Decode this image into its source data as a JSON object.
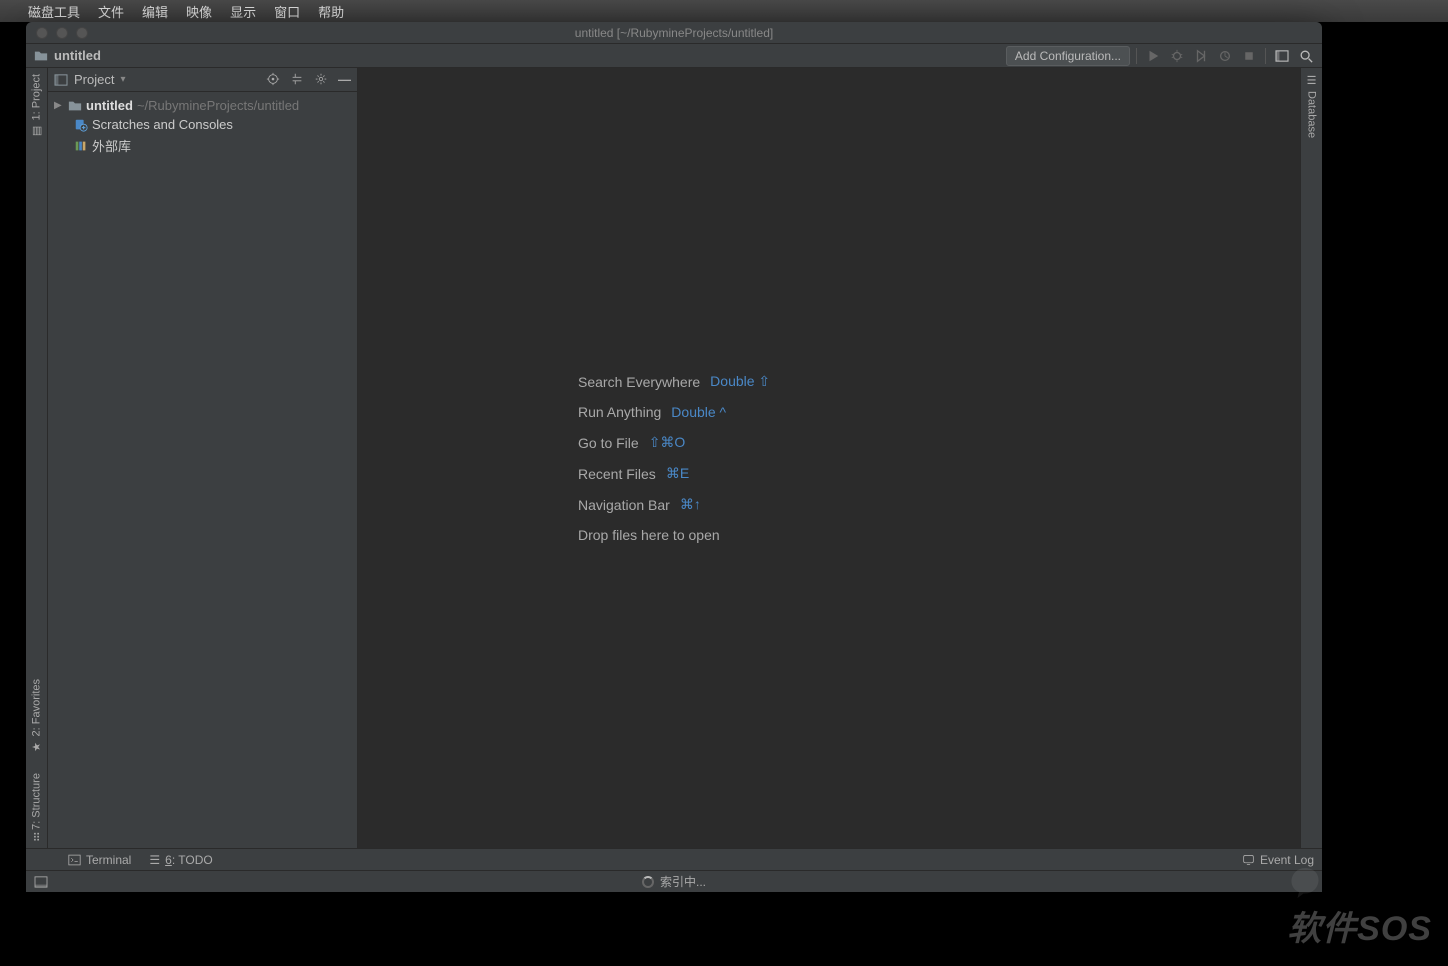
{
  "mac_menu": [
    "磁盘工具",
    "文件",
    "编辑",
    "映像",
    "显示",
    "窗口",
    "帮助"
  ],
  "window_title": "untitled [~/RubymineProjects/untitled]",
  "breadcrumb": "untitled",
  "add_config_label": "Add Configuration...",
  "project_panel": {
    "title": "Project",
    "tree": {
      "root_name": "untitled",
      "root_path": "~/RubymineProjects/untitled",
      "scratches": "Scratches and Consoles",
      "external": "外部库"
    }
  },
  "left_tabs": {
    "project": "1: Project",
    "favorites": "2: Favorites",
    "structure": "7: Structure"
  },
  "right_tabs": {
    "database": "Database"
  },
  "hints": [
    {
      "label": "Search Everywhere",
      "key": "Double ⇧"
    },
    {
      "label": "Run Anything",
      "key": "Double ^"
    },
    {
      "label": "Go to File",
      "key": "⇧⌘O"
    },
    {
      "label": "Recent Files",
      "key": "⌘E"
    },
    {
      "label": "Navigation Bar",
      "key": "⌘↑"
    },
    {
      "label": "Drop files here to open",
      "key": ""
    }
  ],
  "status": {
    "terminal": "Terminal",
    "todo": "6: TODO",
    "event_log": "Event Log",
    "indexing": "索引中..."
  },
  "watermark": "软件SOS"
}
